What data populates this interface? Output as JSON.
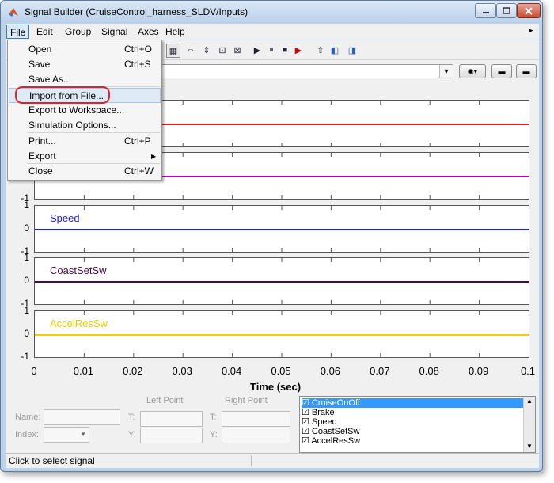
{
  "window": {
    "title": "Signal Builder (CruiseControl_harness_SLDV/Inputs)"
  },
  "menubar": {
    "items": [
      "File",
      "Edit",
      "Group",
      "Signal",
      "Axes",
      "Help"
    ]
  },
  "file_menu": {
    "items": [
      {
        "label": "Open",
        "shortcut": "Ctrl+O"
      },
      {
        "label": "Save",
        "shortcut": "Ctrl+S"
      },
      {
        "label": "Save As...",
        "shortcut": ""
      },
      {
        "label": "Import from File...",
        "shortcut": ""
      },
      {
        "label": "Export to Workspace...",
        "shortcut": ""
      },
      {
        "label": "Simulation Options...",
        "shortcut": ""
      },
      {
        "label": "Print...",
        "shortcut": "Ctrl+P"
      },
      {
        "label": "Export",
        "shortcut": ""
      },
      {
        "label": "Close",
        "shortcut": "Ctrl+W"
      }
    ],
    "highlighted": "Import from File..."
  },
  "plots": {
    "signals": [
      {
        "name": "CruiseOnOff",
        "color": "#e02020",
        "show_label": false
      },
      {
        "name": "Brake",
        "color": "#bb00bb",
        "show_label": false
      },
      {
        "name": "Speed",
        "color": "#2020e0",
        "show_label": true
      },
      {
        "name": "CoastSetSw",
        "color": "#4b0a4b",
        "show_label": true
      },
      {
        "name": "AccelResSw",
        "color": "#f0d000",
        "show_label": true
      }
    ],
    "ytick_top": "1",
    "ytick_mid": "0",
    "ytick_bottom": "-1",
    "xlabel": "Time (sec)",
    "xticks": [
      "0",
      "0.01",
      "0.02",
      "0.03",
      "0.04",
      "0.05",
      "0.06",
      "0.07",
      "0.08",
      "0.09",
      "0.1"
    ]
  },
  "bottom_panel": {
    "left_point": "Left Point",
    "right_point": "Right Point",
    "name_label": "Name:",
    "index_label": "Index:",
    "t_label": "T:",
    "y_label": "Y:"
  },
  "signal_list": {
    "items": [
      "CruiseOnOff",
      "Brake",
      "Speed",
      "CoastSetSw",
      "AccelResSw"
    ],
    "selected": "CruiseOnOff"
  },
  "status": {
    "text": "Click to select signal"
  },
  "colors": {
    "selection": "#3399ff",
    "highlight_ring": "#e3202a"
  }
}
